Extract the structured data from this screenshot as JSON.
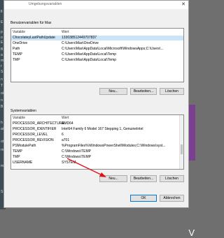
{
  "background": {
    "left_lines": [
      "fi",
      "E",
      "p",
      "o",
      "E",
      "B",
      "a",
      "m",
      "r",
      "S",
      "n",
      "T",
      "ok",
      "n",
      "B",
      "h",
      "ak",
      "ot",
      "rn",
      "m",
      "S"
    ],
    "right_letter": "V"
  },
  "dialog": {
    "title": "Umgebungsvariablen",
    "close_glyph": "✕",
    "user_section_label": "Benutzervariablen für Max",
    "system_section_label": "Systemvariablen",
    "column_variable": "Variable",
    "column_value": "Wert",
    "user_variables": [
      {
        "name": "ChocolateyLastPathUpdate",
        "value": "133038512449707837",
        "selected": true
      },
      {
        "name": "OneDrive",
        "value": "C:\\Users\\Max\\OneDrive"
      },
      {
        "name": "Path",
        "value": "C:\\Users\\Max\\AppData\\Local\\Microsoft\\WindowsApps;C:\\Users\\..."
      },
      {
        "name": "TEMP",
        "value": "C:\\Users\\Max\\AppData\\Local\\Temp"
      },
      {
        "name": "TMP",
        "value": "C:\\Users\\Max\\AppData\\Local\\Temp"
      }
    ],
    "system_variables": [
      {
        "name": "PROCESSOR_ARCHITECTURE",
        "value": "AMD64"
      },
      {
        "name": "PROCESSOR_IDENTIFIER",
        "value": "Intel64 Family 6 Model 167 Stepping 1, GenuineIntel"
      },
      {
        "name": "PROCESSOR_LEVEL",
        "value": "6"
      },
      {
        "name": "PROCESSOR_REVISION",
        "value": "a701"
      },
      {
        "name": "PSModulePath",
        "value": "%ProgramFiles%\\WindowsPowerShell\\Modules;C:\\Windows\\syst..."
      },
      {
        "name": "TEMP",
        "value": "C:\\Windows\\TEMP"
      },
      {
        "name": "TMP",
        "value": "C:\\Windows\\TEMP"
      },
      {
        "name": "USERNAME",
        "value": "SYSTEM"
      }
    ],
    "buttons": {
      "new": "Neu...",
      "edit": "Bearbeiten...",
      "delete": "Löschen",
      "ok": "OK",
      "cancel": "Abbrechen"
    },
    "accent_color": "#0078d7",
    "arrow_color": "#e0101a"
  }
}
